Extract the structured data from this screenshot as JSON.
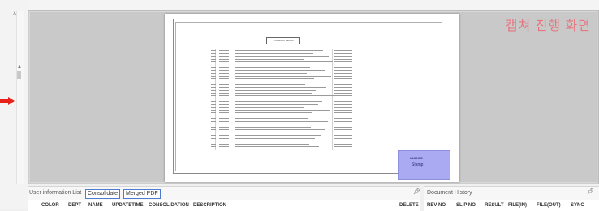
{
  "viewer": {
    "capture_label": "캡쳐 진행 화면",
    "document_title": "Production Record"
  },
  "stamp": {
    "logo": "UNIDOC",
    "text": "Stamp"
  },
  "user_panel": {
    "title": "User information List",
    "tabs": [
      "Consolidate",
      "Merged PDF"
    ],
    "pin_icon": "pin-icon",
    "columns": [
      "COLOR",
      "DEPT",
      "NAME",
      "UPDATETIME",
      "CONSOLIDATION",
      "DESCRIPTION",
      "DELETE"
    ]
  },
  "history_panel": {
    "title": "Document History",
    "pin_icon": "pin-icon",
    "columns": [
      "REV NO",
      "SLIP NO",
      "RESULT",
      "FILE(IN)",
      "FILE(OUT)",
      "SYNC"
    ]
  },
  "colors": {
    "accent": "#4d7bd1",
    "capture_label": "#e8747e",
    "arrow": "#e8201a",
    "stamp": "#a9aaf2"
  }
}
